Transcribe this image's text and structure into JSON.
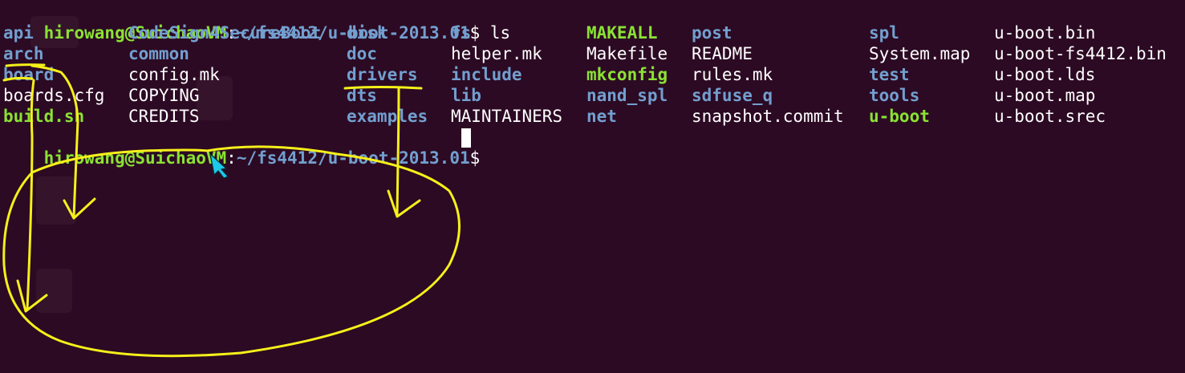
{
  "terminal": {
    "line1": {
      "user_host": "hirowang@SuichaoVM",
      "colon": ":",
      "path": "~/fs4412/u-boot-2013.01",
      "dollar": "$",
      "command": " ls"
    },
    "columns": [
      [
        "api",
        "arch",
        "board",
        "boards.cfg",
        "build.sh"
      ],
      [
        "CodeSign4SecureBoot",
        "common",
        "config.mk",
        "COPYING",
        "CREDITS"
      ],
      [
        "disk",
        "doc",
        "drivers",
        "dts",
        "examples"
      ],
      [
        "fs",
        "helper.mk",
        "include",
        "lib",
        "MAINTAINERS"
      ],
      [
        "MAKEALL",
        "Makefile",
        "mkconfig",
        "nand_spl",
        "net"
      ],
      [
        "post",
        "README",
        "rules.mk",
        "sdfuse_q",
        "snapshot.commit"
      ],
      [
        "spl",
        "System.map",
        "test",
        "tools",
        "u-boot"
      ],
      [
        "u-boot.bin",
        "u-boot-fs4412.bin",
        "u-boot.lds",
        "u-boot.map",
        "u-boot.srec"
      ]
    ],
    "column_kinds": [
      [
        "dir",
        "dir",
        "dir",
        "file",
        "exec"
      ],
      [
        "dir",
        "dir",
        "file",
        "file",
        "file"
      ],
      [
        "dir",
        "dir",
        "dir",
        "dir",
        "dir"
      ],
      [
        "dir",
        "file",
        "dir",
        "dir",
        "file"
      ],
      [
        "exec",
        "file",
        "exec",
        "dir",
        "dir"
      ],
      [
        "dir",
        "file",
        "file",
        "dir",
        "file"
      ],
      [
        "dir",
        "file",
        "dir",
        "dir",
        "exec"
      ],
      [
        "file",
        "file",
        "file",
        "file",
        "file"
      ]
    ],
    "line2": {
      "user_host": "hirowang@SuichaoVM",
      "colon": ":",
      "path": "~/fs4412/u-boot-2013.01",
      "dollar": "$",
      "trailing": " "
    }
  },
  "colors": {
    "background": "#2c0a23",
    "directory": "#729fcf",
    "executable": "#8ae234",
    "file": "#ffffff",
    "annotation": "#f5f01a"
  },
  "icons": {
    "mouse_cursor": "pen-cursor-icon"
  }
}
